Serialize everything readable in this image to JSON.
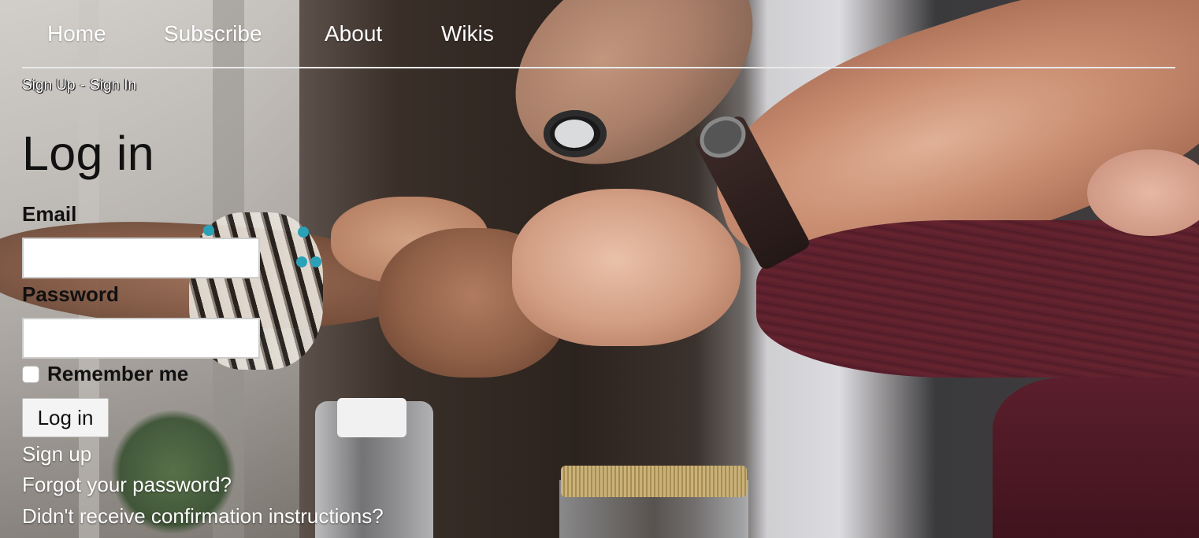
{
  "nav": {
    "items": [
      {
        "label": "Home"
      },
      {
        "label": "Subscribe"
      },
      {
        "label": "About"
      },
      {
        "label": "Wikis"
      }
    ]
  },
  "subnav": {
    "sign_up": "Sign Up",
    "separator": "-",
    "sign_in": "Sign In"
  },
  "form": {
    "title": "Log in",
    "email_label": "Email",
    "email_value": "",
    "password_label": "Password",
    "password_value": "",
    "remember_label": "Remember me",
    "remember_checked": false,
    "submit_label": "Log in"
  },
  "links": {
    "sign_up": "Sign up",
    "forgot_password": "Forgot your password?",
    "confirmation": "Didn't receive confirmation instructions?"
  }
}
